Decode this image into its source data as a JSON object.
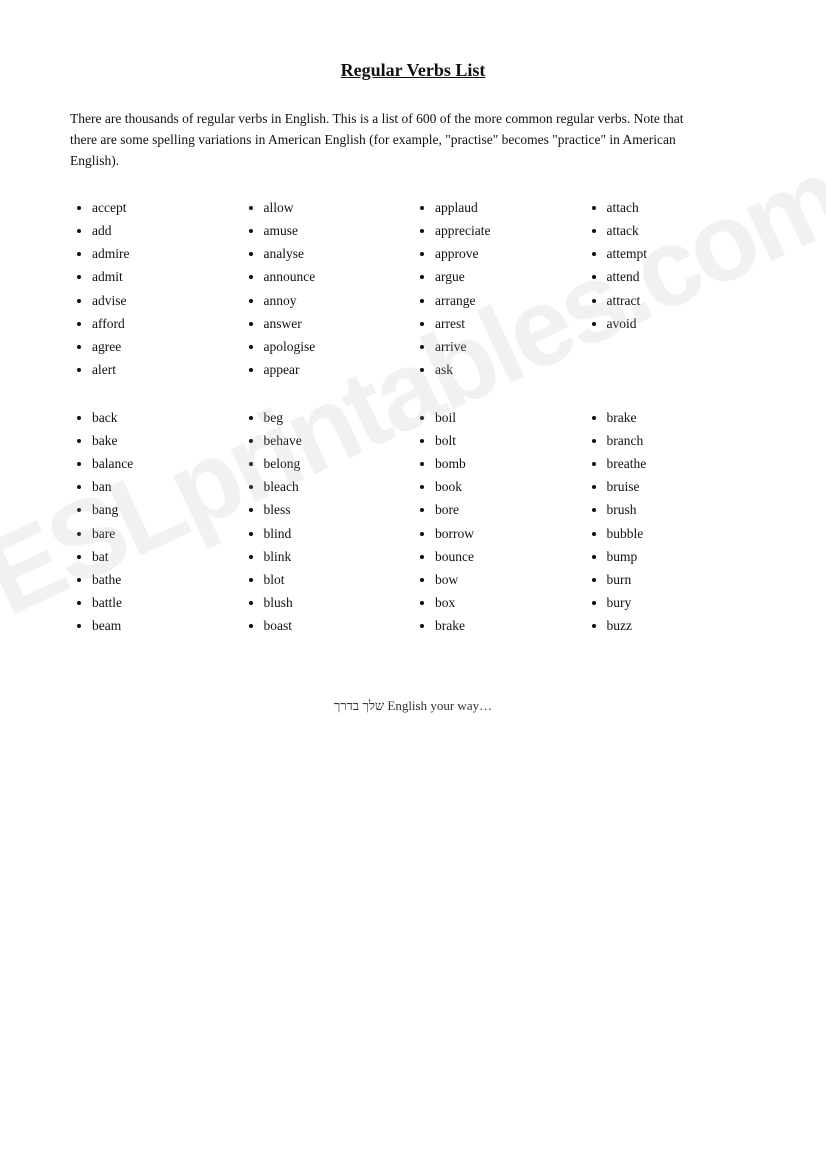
{
  "title": "Regular Verbs List",
  "intro": "There are thousands of regular verbs in English. This is a list of 600 of the more common regular verbs. Note that there are some spelling variations in American English (for example, \"practise\" becomes \"practice\" in American English).",
  "watermark": "ESLprintables.com",
  "footer": "שלך בדרך English your way…",
  "sections": [
    {
      "id": "a",
      "columns": [
        [
          "accept",
          "add",
          "admire",
          "admit",
          "advise",
          "afford",
          "agree",
          "alert"
        ],
        [
          "allow",
          "amuse",
          "analyse",
          "announce",
          "annoy",
          "answer",
          "apologise",
          "appear"
        ],
        [
          "applaud",
          "appreciate",
          "approve",
          "argue",
          "arrange",
          "arrest",
          "arrive",
          "ask"
        ],
        [
          "attach",
          "attack",
          "attempt",
          "attend",
          "attract",
          "avoid"
        ]
      ]
    },
    {
      "id": "b",
      "columns": [
        [
          "back",
          "bake",
          "balance",
          "ban",
          "bang",
          "bare",
          "bat",
          "bathe",
          "battle",
          "beam"
        ],
        [
          "beg",
          "behave",
          "belong",
          "bleach",
          "bless",
          "blind",
          "blink",
          "blot",
          "blush",
          "boast"
        ],
        [
          "boil",
          "bolt",
          "bomb",
          "book",
          "bore",
          "borrow",
          "bounce",
          "bow",
          "box",
          "brake"
        ],
        [
          "brake",
          "branch",
          "breathe",
          "bruise",
          "brush",
          "bubble",
          "bump",
          "burn",
          "bury",
          "buzz"
        ]
      ]
    }
  ]
}
